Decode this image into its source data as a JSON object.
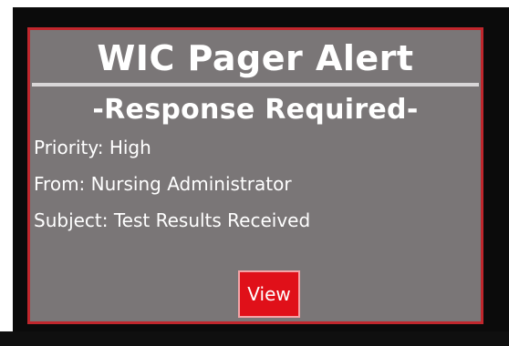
{
  "alert": {
    "title": "WIC Pager Alert",
    "subtitle": "-Response Required-",
    "priority": "Priority: High",
    "from": "From: Nursing Administrator",
    "subject": "Subject: Test Results Received",
    "view_label": "View"
  },
  "colors": {
    "panel_background": "#7a7677",
    "panel_border": "#c0272d",
    "button_background": "#e01019",
    "screen_background": "#0b0b0b",
    "text": "#ffffff"
  }
}
